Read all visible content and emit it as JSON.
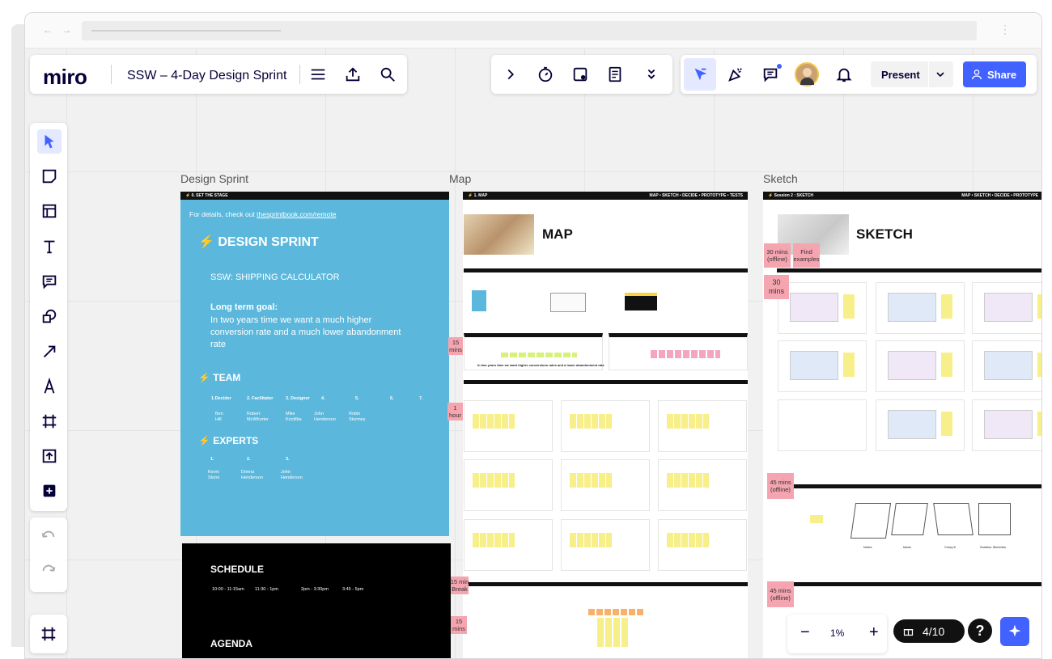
{
  "app": {
    "logo": "miro",
    "board_name": "SSW – 4-Day Design Sprint"
  },
  "browser": {
    "nav": "← →",
    "menu": "⋮"
  },
  "toolbar_top": {
    "present_label": "Present",
    "share_label": "Share",
    "icons": [
      "chevron-right-icon",
      "timer-icon",
      "card-icon",
      "notes-icon",
      "chevron-double-down-icon",
      "cursor-icon",
      "celebrate-icon",
      "comments-icon",
      "avatar",
      "bell-icon"
    ]
  },
  "left_tools": [
    "select",
    "sticky-note",
    "template",
    "text",
    "comment",
    "shapes",
    "arrow",
    "pen",
    "frame",
    "upload",
    "add"
  ],
  "frames": {
    "design_sprint_title": "Design Sprint",
    "map_title": "Map",
    "sketch_title": "Sketch"
  },
  "design_sprint": {
    "bar": "⚡ 0. SET THE STAGE",
    "details_prefix": "For details, check out ",
    "details_link": "thesprintbook.com/remote",
    "heading": "⚡ DESIGN SPRINT",
    "subject": "SSW: SHIPPING CALCULATOR",
    "goal_label": "Long term goal:",
    "goal_text": "In two years time we want a much higher conversion rate and a much lower abandonment rate",
    "team_heading": "⚡ TEAM",
    "team_roles": [
      "1.Decider",
      "2. Facilitator",
      "3. Designer",
      "4.",
      "5.",
      "6.",
      "7."
    ],
    "team_names": [
      "Ben\nHill",
      "Robert\nMcWhorter",
      "Mike\nKoctilba",
      "John\nHenderson",
      "Robin\nSturmey"
    ],
    "experts_heading": "⚡ EXPERTS",
    "expert_nums": [
      "1.",
      "2.",
      "3."
    ],
    "expert_names": [
      "Kevin\nStone",
      "Donna\nHenderson",
      "John\nHenderson"
    ]
  },
  "schedule": {
    "heading": "SCHEDULE",
    "times": [
      "10:00 - 11:15am",
      "11:30 - 1pm",
      "2pm - 3:30pm",
      "3:45 - 5pm"
    ],
    "agenda": "AGENDA"
  },
  "map": {
    "bar": "⚡ 1. MAP",
    "bar_right": "MAP • SKETCH • DECIDE • PROTOTYPE • TESTS",
    "heading": "MAP",
    "sticky_15": "15\nmins",
    "sticky_1h": "1\nhour",
    "sticky_15break": "15 min\nBreak",
    "sticky_15b": "15\nmins",
    "long_term_note": "In two years time we want higher conversions rates and a lower abandonment rate"
  },
  "sketch": {
    "bar": "⚡ Session 2 : SKETCH",
    "bar_right": "MAP • SKETCH • DECIDE • PROTOTYPE",
    "heading": "SKETCH",
    "sticky_30off": "30 mins\n(offline)",
    "sticky_find": "Find\nexamples",
    "sticky_30": "30\nmins",
    "sticky_45a": "45 mins\n(offline)",
    "sticky_45b": "45 mins\n(offline)",
    "sketch_labels": [
      "Notes",
      "Ideas",
      "Crazy 8",
      "Solution Sketches"
    ]
  },
  "bottom": {
    "zoom": "1%",
    "minus": "−",
    "plus": "+",
    "pages": "4/10",
    "help": "?"
  },
  "colors": {
    "accent": "#4262ff",
    "sprint_blue": "#5bb8dc",
    "sticky_pink": "#f4a5b0",
    "sticky_yellow": "#f7ef8a"
  }
}
